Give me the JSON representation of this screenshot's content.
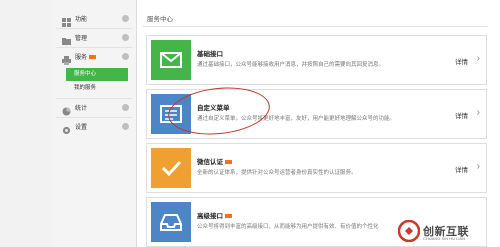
{
  "sidebar": {
    "items": [
      {
        "label": "功能",
        "icon": "grid-icon"
      },
      {
        "label": "管理",
        "icon": "folder-icon"
      },
      {
        "label": "服务",
        "icon": "printer-icon",
        "badge": true
      },
      {
        "label": "统计",
        "icon": "chart-icon"
      },
      {
        "label": "设置",
        "icon": "gear-icon"
      }
    ],
    "sub_items": [
      {
        "label": "服务中心",
        "active": true
      },
      {
        "label": "我的服务",
        "active": false
      }
    ]
  },
  "main": {
    "title": "服务中心",
    "cards": [
      {
        "name": "基础接口",
        "desc": "通过基础接口，公众号能够接收用户消息，并按照自己的需要向其回复消息。",
        "link": "详情",
        "tile_color": "#44b549",
        "icon": "envelope-icon",
        "badge": false
      },
      {
        "name": "自定义菜单",
        "desc": "通过自定义菜单，公众号将更好地丰富，友好，用户能更好地理解公众号的功能。",
        "link": "详情",
        "tile_color": "#4c86c6",
        "icon": "menu-screen-icon",
        "badge": false
      },
      {
        "name": "微信认证",
        "desc": "全新的认证体系，提供针对公众号运营者身份真实性的认证服务。",
        "link": "详情",
        "tile_color": "#f0a030",
        "icon": "checkmark-icon",
        "badge": true
      },
      {
        "name": "高级接口",
        "desc": "公众号将得到丰富的高级接口，从而能够为用户提供有效、有价值的个性化",
        "link": "",
        "tile_color": "#4c86c6",
        "icon": "inbox-tray-icon",
        "badge": true
      }
    ]
  },
  "watermark": {
    "text": "创新互联",
    "sub": "CHUANG XIN HU LIAN"
  },
  "colors": {
    "accent": "#44b549",
    "badge": "#ff6e1e",
    "highlight_ellipse": "#c0352e"
  }
}
